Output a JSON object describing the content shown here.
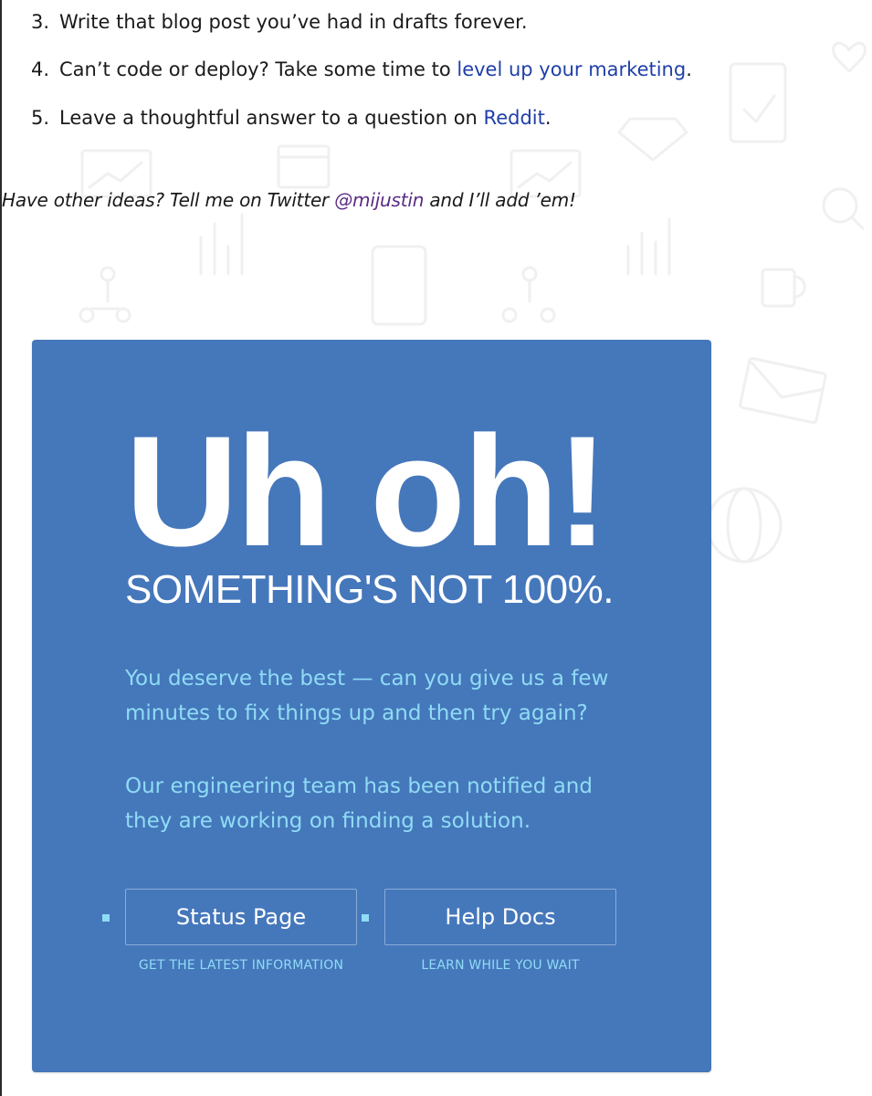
{
  "article": {
    "items": [
      {
        "number": "3.",
        "text": "Write that blog post you’ve had in drafts forever.",
        "link": "",
        "suffix": ""
      },
      {
        "number": "4.",
        "text": "Can’t code or deploy? Take some time to ",
        "link": "level up your marketing",
        "suffix": "."
      },
      {
        "number": "5.",
        "text": "Leave a thoughtful answer to a question on ",
        "link": "Reddit",
        "suffix": "."
      }
    ],
    "closing": {
      "before": "Have other ideas? Tell me on Twitter ",
      "handle": "@mijustin",
      "after": " and I’ll add ’em!"
    }
  },
  "error_card": {
    "headline": "Uh oh!",
    "subheadline": "SOMETHING'S NOT 100%.",
    "message_1": "You deserve the best — can you give us a few minutes to fix things up and then try again?",
    "message_2": "Our engineering team has been notified and they are working on finding a solution.",
    "buttons": [
      {
        "label": "Status Page",
        "caption": "GET THE LATEST INFORMATION"
      },
      {
        "label": "Help Docs",
        "caption": "LEARN WHILE YOU WAIT"
      }
    ]
  },
  "colors": {
    "card_background": "#4577bb",
    "accent_text": "#8fdcf5",
    "link": "#1f3fa8",
    "twitter_link": "#5a2b86"
  },
  "icons": [
    "background-doodle-icons",
    "bullet-square-icon"
  ]
}
